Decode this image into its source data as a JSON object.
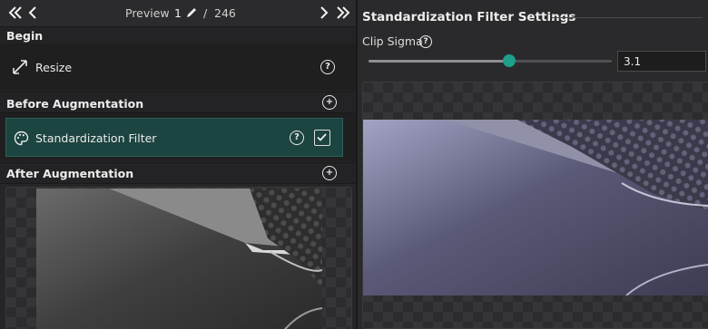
{
  "toolbar": {
    "first_icon": "double-chevron-left-icon",
    "prev_icon": "chevron-left-icon",
    "preview_label": "Preview",
    "current_index": "1",
    "edit_icon": "pencil-icon",
    "separator": "/",
    "total": "246",
    "next_icon": "chevron-right-icon",
    "last_icon": "double-chevron-right-icon"
  },
  "sections": {
    "begin": {
      "title": "Begin",
      "items": [
        {
          "label": "Resize",
          "icon": "resize-arrows-icon",
          "help": "?"
        }
      ]
    },
    "before": {
      "title": "Before Augmentation",
      "add_icon": "plus-icon",
      "items": [
        {
          "label": "Standardization Filter",
          "icon": "palette-icon",
          "help": "?",
          "checked": true
        }
      ]
    },
    "after": {
      "title": "After Augmentation",
      "add_icon": "plus-icon"
    }
  },
  "settings": {
    "title": "Standardization Filter Settings",
    "clip_sigma_label": "Clip Sigma",
    "help": "?",
    "clip_sigma_value": "3.1",
    "slider_fraction": 0.58,
    "accent_color": "#1f9e8c"
  }
}
